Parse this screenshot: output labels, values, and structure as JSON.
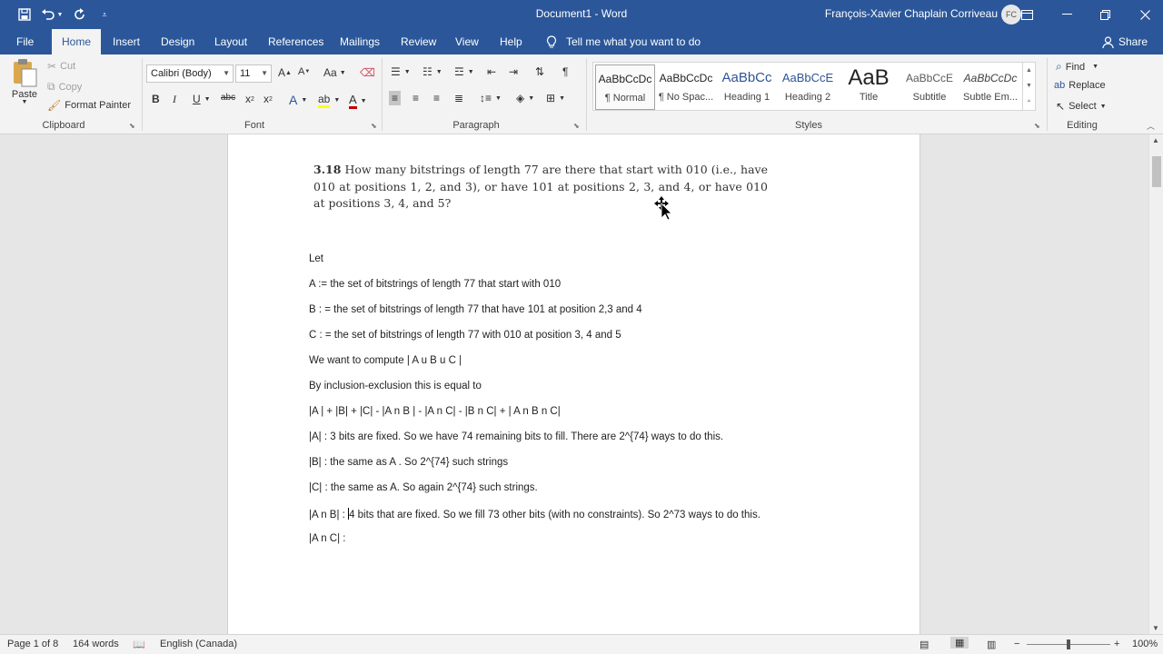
{
  "window": {
    "doc_title": "Document1  -  Word",
    "user_name": "François-Xavier Chaplain Corriveau",
    "user_initials": "FC"
  },
  "tabs": [
    {
      "label": "File"
    },
    {
      "label": "Home"
    },
    {
      "label": "Insert"
    },
    {
      "label": "Design"
    },
    {
      "label": "Layout"
    },
    {
      "label": "References"
    },
    {
      "label": "Mailings"
    },
    {
      "label": "Review"
    },
    {
      "label": "View"
    },
    {
      "label": "Help"
    }
  ],
  "tell_me": "Tell me what you want to do",
  "share": "Share",
  "clipboard": {
    "paste": "Paste",
    "cut": "Cut",
    "copy": "Copy",
    "format_painter": "Format Painter",
    "label": "Clipboard"
  },
  "font": {
    "family": "Calibri (Body)",
    "size": "11",
    "label": "Font"
  },
  "paragraph": {
    "label": "Paragraph"
  },
  "styles": {
    "label": "Styles",
    "items": [
      {
        "preview": "AaBbCcDc",
        "name": "¶ Normal"
      },
      {
        "preview": "AaBbCcDc",
        "name": "¶ No Spac..."
      },
      {
        "preview": "AaBbCc",
        "name": "Heading 1"
      },
      {
        "preview": "AaBbCcE",
        "name": "Heading 2"
      },
      {
        "preview": "AaB",
        "name": "Title"
      },
      {
        "preview": "AaBbCcE",
        "name": "Subtitle"
      },
      {
        "preview": "AaBbCcDc",
        "name": "Subtle Em..."
      }
    ]
  },
  "editing": {
    "find": "Find",
    "replace": "Replace",
    "select": "Select",
    "label": "Editing"
  },
  "document": {
    "problem_number": "3.18",
    "problem_text": "How many bitstrings of length 77 are there that start with 010 (i.e., have 010 at positions 1, 2, and 3), or have 101 at positions 2, 3, and 4, or have 010 at positions 3, 4, and 5?",
    "lines": [
      "Let",
      "A := the set of bitstrings of length 77 that start with 010",
      "B : = the set of bitstrings of length 77 that have 101 at position 2,3 and 4",
      "C : = the set of bitstrings of length 77 with 010 at position 3, 4 and 5",
      "We want to compute | A u B u C |",
      "By inclusion-exclusion this is equal to",
      "|A | + |B| + |C| - |A n B | - |A n C| - |B n C| + | A n B n C|",
      "|A| :  3 bits are fixed. So we have 74 remaining bits to fill. There are 2^{74} ways to do this.",
      "|B| :  the same as A . So 2^{74} such strings",
      "|C| : the same as A. So again 2^{74} such strings.",
      "|A n B| : ",
      "|A n C| :"
    ],
    "line_ab_rest": "4 bits that are fixed. So we fill 73 other bits (with no constraints). So 2^73 ways to do this."
  },
  "status": {
    "page": "Page 1 of 8",
    "words": "164 words",
    "language": "English (Canada)",
    "zoom": "100%"
  },
  "colors": {
    "accent": "#2b579a",
    "ribbon": "#f3f3f3",
    "workspace": "#e6e6e6"
  }
}
